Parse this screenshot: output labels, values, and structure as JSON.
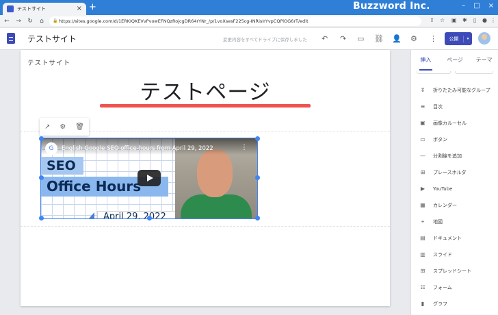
{
  "browser": {
    "tab_title": "テストサイト",
    "tab_close": "×",
    "new_tab": "+",
    "brand": "Buzzword Inc.",
    "url": "https://sites.google.com/d/1ERKIQKEVvPvowEFNQzRojcgDR64rYNr_/p/1voXsesF225cg-INRisIrYvpCQPiOG6rT/edit",
    "nav": {
      "back": "←",
      "forward": "→",
      "reload": "↻",
      "home": "⌂"
    },
    "window_controls": [
      "–",
      "□",
      "×"
    ]
  },
  "app": {
    "site_title": "テストサイト",
    "save_status": "変更内容をすべてドライブに保存しました",
    "publish_label": "公開",
    "publish_dropdown": "▾",
    "header_icons": [
      "↶",
      "↷",
      "▭",
      "⛓",
      "👤",
      "⚙",
      "⋮"
    ]
  },
  "canvas": {
    "site_nav_title": "テストサイト",
    "page_title": "テストページ",
    "toolbar_icons": [
      "↗",
      "⚙",
      "🗑"
    ]
  },
  "video": {
    "channel_icon": "G",
    "title": "English Google SEO office-hours from April 29, 2022",
    "menu": "⋮",
    "thumb_line1": "SEO",
    "thumb_line2": "Office Hours",
    "thumb_date": "April 29, 2022"
  },
  "panel": {
    "tabs": [
      "挿入",
      "ページ",
      "テーマ"
    ],
    "active_tab": "挿入",
    "items": [
      {
        "icon": "collapse-icon",
        "glyph": "⇕",
        "label": "折りたたみ可能なグループ"
      },
      {
        "icon": "toc-icon",
        "glyph": "≡",
        "label": "目次"
      },
      {
        "icon": "carousel-icon",
        "glyph": "▣",
        "label": "画像カルーセル"
      },
      {
        "icon": "button-icon",
        "glyph": "▭",
        "label": "ボタン"
      },
      {
        "icon": "divider-icon",
        "glyph": "—",
        "label": "分割線を追加"
      },
      {
        "icon": "placeholder-icon",
        "glyph": "⊞",
        "label": "プレースホルダ"
      },
      {
        "icon": "youtube-icon",
        "glyph": "▶",
        "label": "YouTube"
      },
      {
        "icon": "calendar-icon",
        "glyph": "▦",
        "label": "カレンダー"
      },
      {
        "icon": "map-icon",
        "glyph": "⌖",
        "label": "地図"
      },
      {
        "icon": "docs-icon",
        "glyph": "▤",
        "label": "ドキュメント"
      },
      {
        "icon": "slides-icon",
        "glyph": "▥",
        "label": "スライド"
      },
      {
        "icon": "sheets-icon",
        "glyph": "⊞",
        "label": "スプレッドシート"
      },
      {
        "icon": "forms-icon",
        "glyph": "☷",
        "label": "フォーム"
      },
      {
        "icon": "chart-icon",
        "glyph": "▮",
        "label": "グラフ"
      }
    ]
  },
  "colors": {
    "accent": "#3c4bb7",
    "title_bar": "#2f7fd6",
    "title_underline": "#ef5350",
    "selection": "#4285f4"
  }
}
